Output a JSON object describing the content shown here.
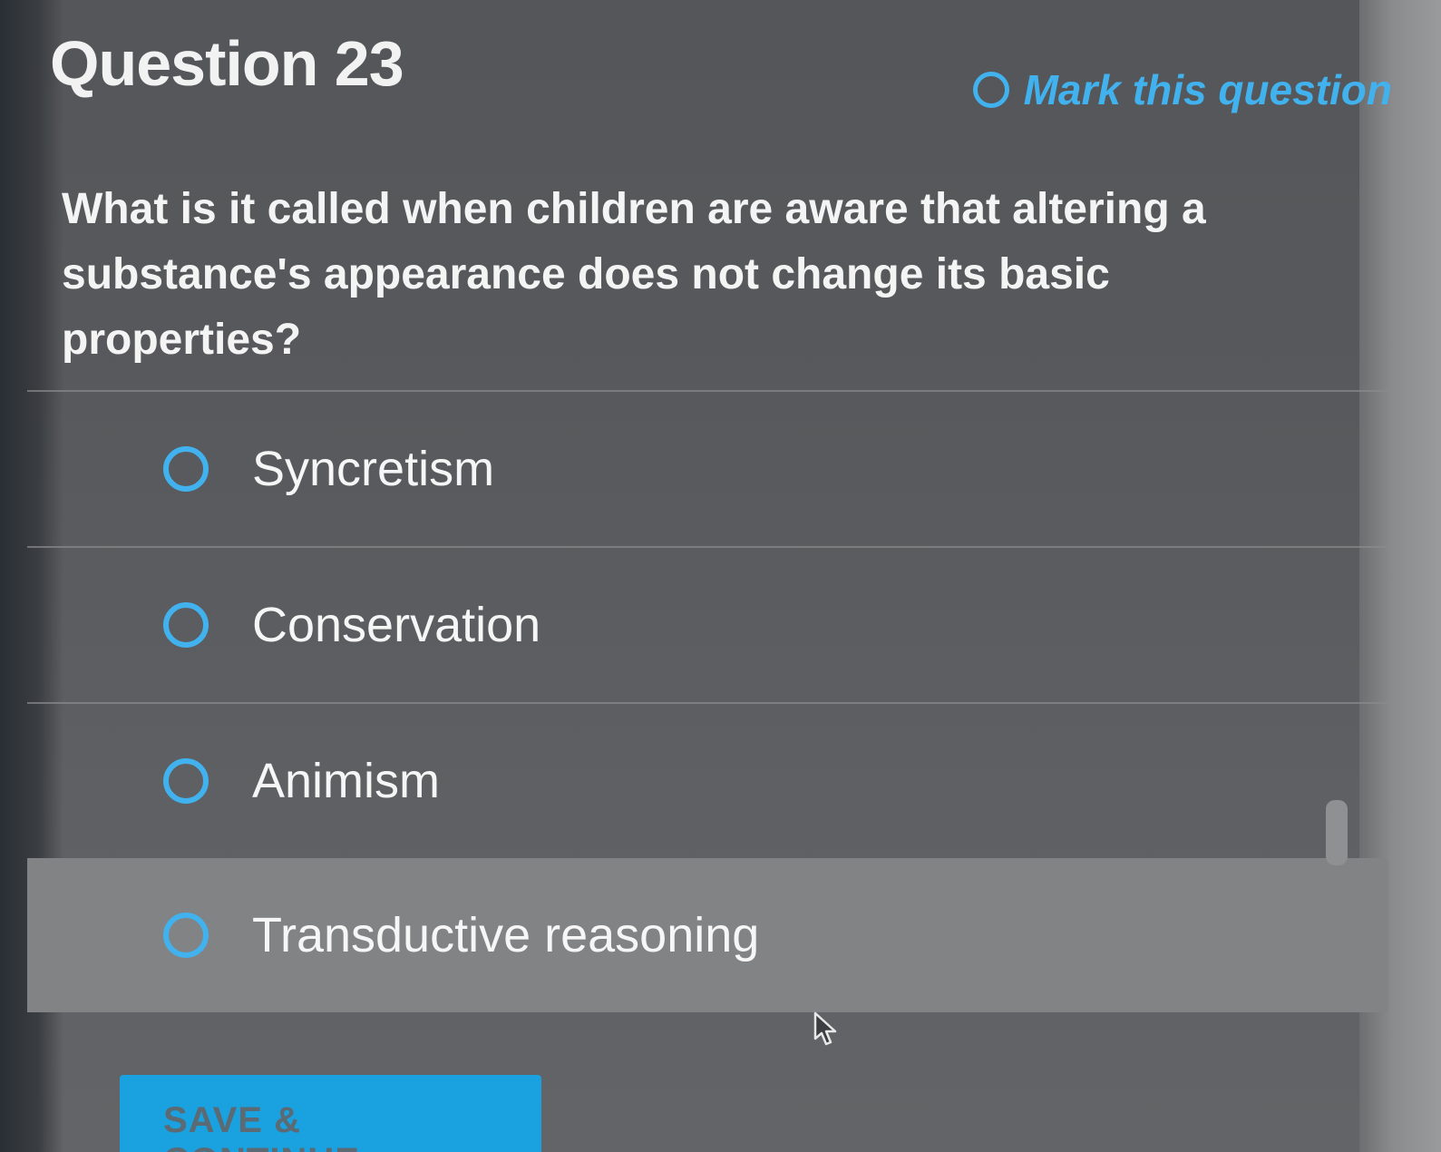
{
  "header": {
    "title": "Question 23",
    "mark_label": "Mark this question"
  },
  "question": {
    "text": "What is it called when children are aware that altering a substance's appearance does not change its basic properties?"
  },
  "options": [
    {
      "label": "Syncretism"
    },
    {
      "label": "Conservation"
    },
    {
      "label": "Animism"
    },
    {
      "label": "Transductive reasoning"
    }
  ],
  "footer": {
    "save_label": "SAVE & CONTINUE"
  },
  "colors": {
    "accent": "#41b2ee",
    "button": "#1aa1e0"
  }
}
